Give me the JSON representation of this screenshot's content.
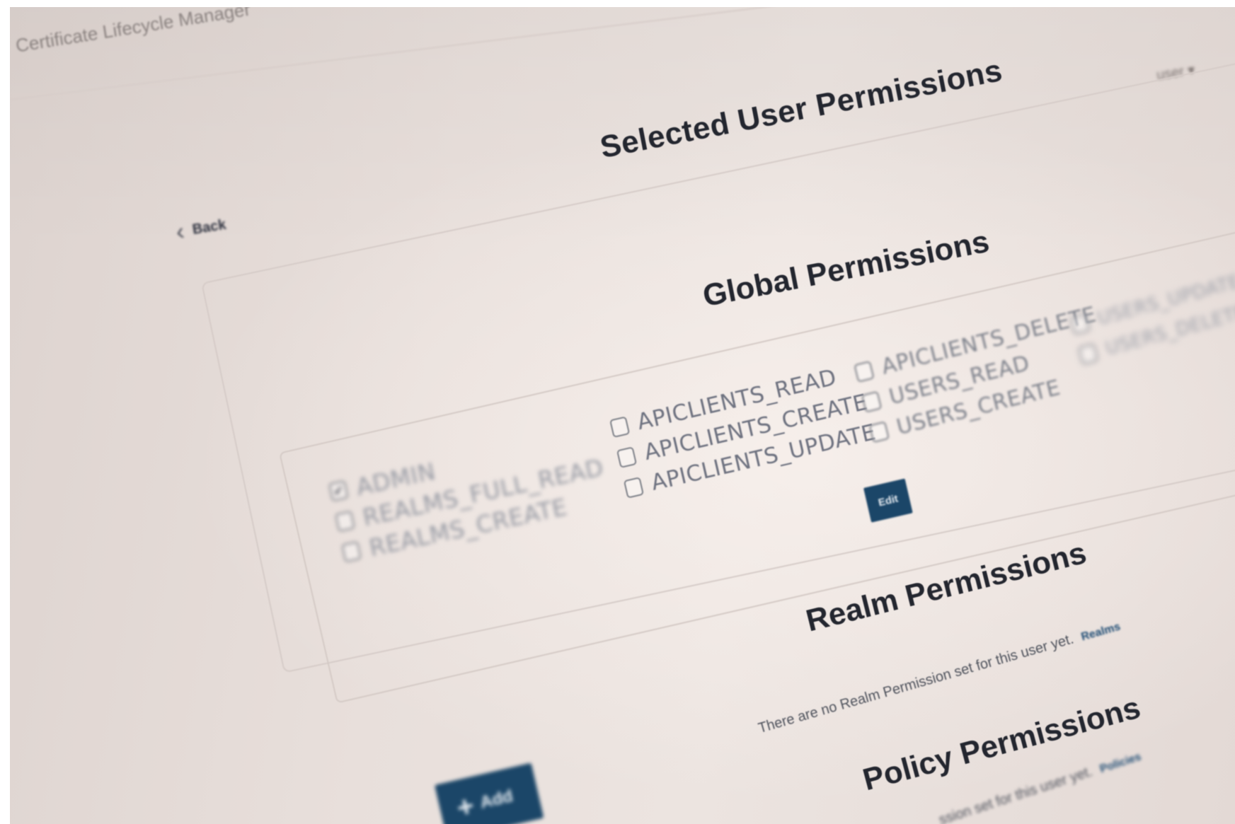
{
  "header": {
    "app_title": "Certificate Lifecycle Manager",
    "user_menu": "user ▾"
  },
  "page": {
    "title": "Selected User Permissions",
    "back_label": "Back"
  },
  "global_permissions": {
    "title": "Global Permissions",
    "columns": [
      [
        {
          "label": "ADMIN",
          "checked": true
        },
        {
          "label": "REALMS_FULL_READ",
          "checked": false
        },
        {
          "label": "REALMS_CREATE",
          "checked": false
        }
      ],
      [
        {
          "label": "APICLIENTS_READ",
          "checked": false
        },
        {
          "label": "APICLIENTS_CREATE",
          "checked": false
        },
        {
          "label": "APICLIENTS_UPDATE",
          "checked": false
        }
      ],
      [
        {
          "label": "APICLIENTS_DELETE",
          "checked": false
        },
        {
          "label": "USERS_READ",
          "checked": false
        },
        {
          "label": "USERS_CREATE",
          "checked": false
        }
      ],
      [
        {
          "label": "USERS_UPDATE",
          "checked": false
        },
        {
          "label": "USERS_DELETE",
          "checked": false
        }
      ]
    ],
    "edit_label": "Edit"
  },
  "realm_permissions": {
    "title": "Realm Permissions",
    "empty_note": "There are no Realm Permission set for this user yet.",
    "link_label": "Realms"
  },
  "policy_permissions": {
    "title": "Policy Permissions",
    "empty_note": "ssion set for this user yet.",
    "link_label": "Policies"
  },
  "add_button": {
    "label": "Add"
  },
  "colors": {
    "primary_button": "#1b4668",
    "link": "#1d4b73",
    "heading": "#23262f",
    "background": "#e8dfdb"
  }
}
